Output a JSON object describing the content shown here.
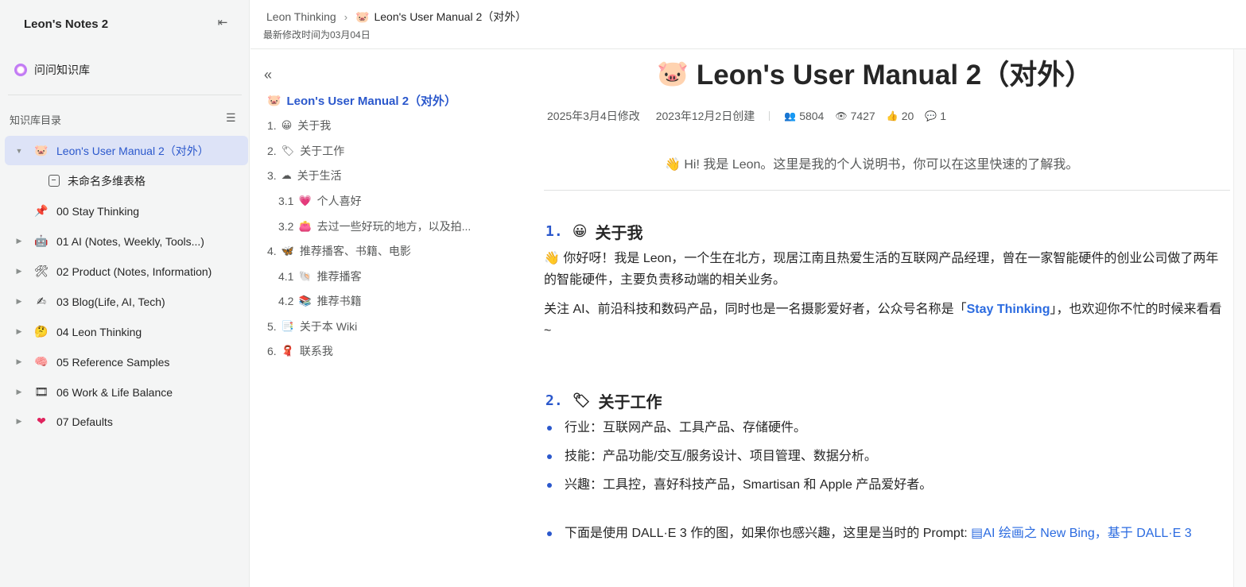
{
  "sidebar": {
    "title": "Leon's Notes 2",
    "ask_label": "问问知识库",
    "section_label": "知识库目录",
    "items": [
      {
        "emoji": "🐷",
        "label": "Leon's User Manual 2（对外）",
        "caret": "▼"
      },
      {
        "emoji": "",
        "label": "未命名多维表格",
        "caret": ""
      },
      {
        "emoji": "📌",
        "label": "00 Stay Thinking",
        "caret": ""
      },
      {
        "emoji": "🤖",
        "label": "01 AI (Notes, Weekly, Tools...)",
        "caret": "▶"
      },
      {
        "emoji": "🛠",
        "label": "02 Product (Notes, Information)",
        "caret": "▶"
      },
      {
        "emoji": "✍",
        "label": "03 Blog(Life, AI, Tech)",
        "caret": "▶"
      },
      {
        "emoji": "🤔",
        "label": "04 Leon Thinking",
        "caret": "▶"
      },
      {
        "emoji": "🧠",
        "label": "05 Reference Samples",
        "caret": "▶"
      },
      {
        "emoji": "🎞",
        "label": "06 Work & Life Balance",
        "caret": "▶"
      },
      {
        "emoji": "❤",
        "label": "07 Defaults",
        "caret": "▶"
      }
    ]
  },
  "header": {
    "breadcrumb_root": "Leon Thinking",
    "breadcrumb_sep": "›",
    "breadcrumb_emoji": "🐷",
    "breadcrumb_current": "Leon's User Manual 2（对外）",
    "modified": "最新修改时间为03月04日"
  },
  "toc": {
    "collapse_glyph": "«",
    "title_emoji": "🐷",
    "title": "Leon's User Manual 2（对外）",
    "items": [
      {
        "num": "1.",
        "emoji": "😀",
        "label": "关于我"
      },
      {
        "num": "2.",
        "emoji": "🏷",
        "label": "关于工作"
      },
      {
        "num": "3.",
        "emoji": "☁",
        "label": "关于生活"
      },
      {
        "num": "3.1",
        "emoji": "💗",
        "label": "个人喜好"
      },
      {
        "num": "3.2",
        "emoji": "👛",
        "label": "去过一些好玩的地方，以及拍..."
      },
      {
        "num": "4.",
        "emoji": "🦋",
        "label": "推荐播客、书籍、电影"
      },
      {
        "num": "4.1",
        "emoji": "🐚",
        "label": "推荐播客"
      },
      {
        "num": "4.2",
        "emoji": "📚",
        "label": "推荐书籍"
      },
      {
        "num": "5.",
        "emoji": "📑",
        "label": "关于本 Wiki"
      },
      {
        "num": "6.",
        "emoji": "🧣",
        "label": "联系我"
      }
    ]
  },
  "doc": {
    "title_emoji": "🐷",
    "title": "Leon's User Manual 2（对外）",
    "modified": "2025年3月4日修改",
    "created": "2023年12月2日创建",
    "readers": "5804",
    "views": "7427",
    "likes": "20",
    "comments": "1",
    "intro": "👋 Hi! 我是 Leon。这里是我的个人说明书，你可以在这里快速的了解我。",
    "sec1_num": "1.",
    "sec1_emoji": "😀",
    "sec1_title": "关于我",
    "p1": "👋 你好呀！我是 Leon，一个生在北方，现居江南且热爱生活的互联网产品经理，曾在一家智能硬件的创业公司做了两年的智能硬件，主要负责移动端的相关业务。",
    "p2_before": "关注 AI、前沿科技和数码产品，同时也是一名摄影爱好者，公众号名称是「",
    "p2_link": "Stay Thinking",
    "p2_after": "」，也欢迎你不忙的时候来看看 ~",
    "sec2_num": "2.",
    "sec2_emoji": "🏷",
    "sec2_title": "关于工作",
    "bullets": [
      "行业：互联网产品、工具产品、存储硬件。",
      "技能：产品功能/交互/服务设计、项目管理、数据分析。",
      "兴趣：工具控，喜好科技产品，Smartisan 和 Apple 产品爱好者。"
    ],
    "bullet4_text": "下面是使用 DALL·E 3 作的图，如果你也感兴趣，这里是当时的 Prompt: ",
    "bullet4_link": "AI 绘画之 New Bing，基于 DALL·E 3"
  },
  "icons": {
    "collapse_sidebar": "⇤",
    "toc_list": "☰",
    "readers": "👥",
    "views": "👁",
    "likes": "👍",
    "comments": "💬",
    "doc_link": "▤"
  },
  "colors": {
    "accent": "#2b58cc",
    "link": "#2b6be0",
    "active_bg": "#dde3f7",
    "sidebar_bg": "#f4f5f5"
  }
}
